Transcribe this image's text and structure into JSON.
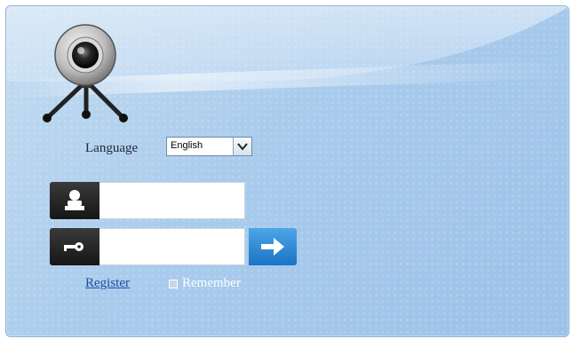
{
  "language": {
    "label": "Language",
    "selected": "English"
  },
  "login": {
    "username_value": "",
    "password_value": ""
  },
  "links": {
    "register": "Register",
    "remember": "Remember"
  },
  "icons": {
    "logo": "webcam-icon",
    "username": "user-icon",
    "password": "key-icon",
    "submit": "arrow-right-icon"
  },
  "colors": {
    "panel_blue": "#a9cbec",
    "submit_blue": "#1a73c4",
    "link_blue": "#1d4ea3"
  }
}
